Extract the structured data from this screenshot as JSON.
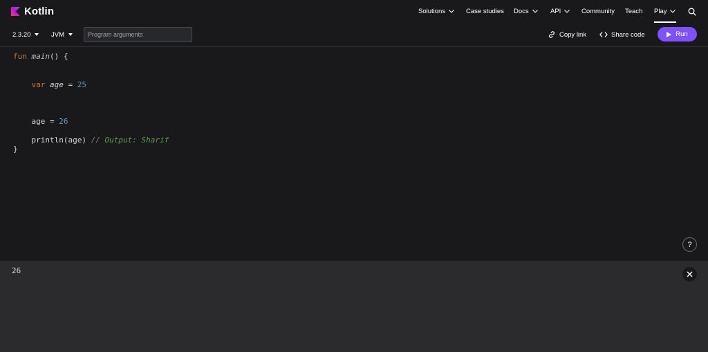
{
  "brand": {
    "name": "Kotlin"
  },
  "nav": {
    "items": [
      {
        "label": "Solutions",
        "has_chevron": true
      },
      {
        "label": "Case studies",
        "has_chevron": false
      },
      {
        "label": "Docs",
        "has_chevron": true
      },
      {
        "label": "API",
        "has_chevron": true
      },
      {
        "label": "Community",
        "has_chevron": false
      },
      {
        "label": "Teach",
        "has_chevron": false
      },
      {
        "label": "Play",
        "has_chevron": true,
        "active": true
      }
    ],
    "search_icon": "search-icon"
  },
  "toolbar": {
    "version": "2.3.20",
    "platform": "JVM",
    "args_placeholder": "Program arguments",
    "args_value": "",
    "copy_link": "Copy link",
    "share_code": "Share code",
    "run": "Run"
  },
  "editor": {
    "lines": {
      "l1_kw": "fun",
      "l1_fn": "main",
      "l1_rest": "() {",
      "l2_kw": "var",
      "l2_name": "age",
      "l2_eq": " = ",
      "l2_num": "25",
      "l3_name": "age",
      "l3_eq": " = ",
      "l3_num": "26",
      "l4_code": "println(age)",
      "l4_comment": "// Output: Sharif",
      "l5_close": "}"
    },
    "help_label": "?"
  },
  "output": {
    "text": "26"
  },
  "colors": {
    "accent": "#7f52ff",
    "background": "#19191c",
    "output_bg": "#2b2b2e",
    "keyword": "#cc7832",
    "number": "#6897bb",
    "comment": "#629755"
  }
}
